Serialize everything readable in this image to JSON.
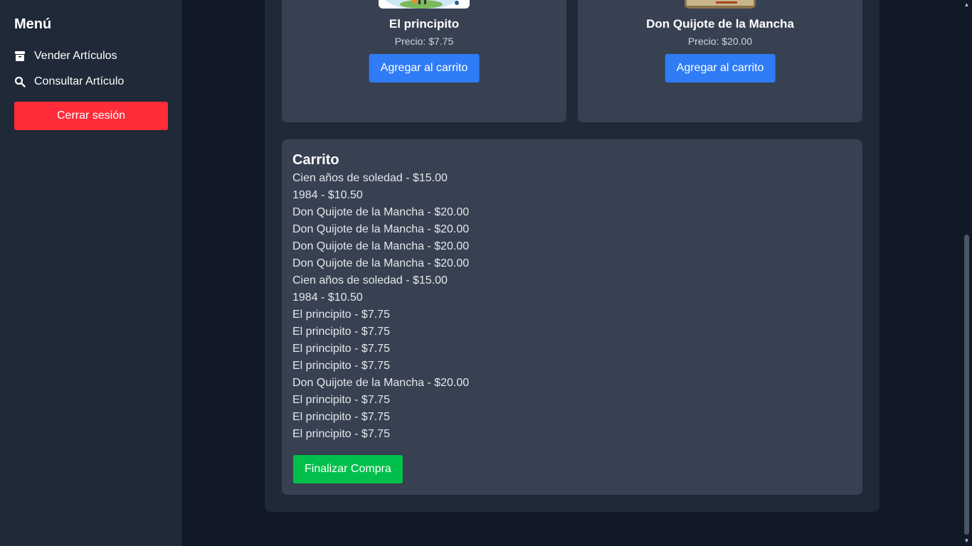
{
  "sidebar": {
    "title": "Menú",
    "items": [
      {
        "label": "Vender Artículos",
        "icon": "box-icon"
      },
      {
        "label": "Consultar Artículo",
        "icon": "search-icon"
      }
    ],
    "logout_label": "Cerrar sesión"
  },
  "products": [
    {
      "title": "El principito",
      "price": "Precio: $7.75",
      "button": "Agregar al carrito"
    },
    {
      "title": "Don Quijote de la Mancha",
      "price": "Precio: $20.00",
      "button": "Agregar al carrito"
    }
  ],
  "cart": {
    "title": "Carrito",
    "items": [
      "Cien años de soledad - $15.00",
      "1984 - $10.50",
      "Don Quijote de la Mancha - $20.00",
      "Don Quijote de la Mancha - $20.00",
      "Don Quijote de la Mancha - $20.00",
      "Don Quijote de la Mancha - $20.00",
      "Cien años de soledad - $15.00",
      "1984 - $10.50",
      "El principito - $7.75",
      "El principito - $7.75",
      "El principito - $7.75",
      "El principito - $7.75",
      "Don Quijote de la Mancha - $20.00",
      "El principito - $7.75",
      "El principito - $7.75",
      "El principito - $7.75"
    ],
    "checkout_label": "Finalizar Compra"
  },
  "colors": {
    "page_bg": "#111827",
    "panel_bg": "#1f2937",
    "card_bg": "#374151",
    "primary": "#2f7cf6",
    "danger": "#ff2d3a",
    "success": "#00c04b"
  }
}
